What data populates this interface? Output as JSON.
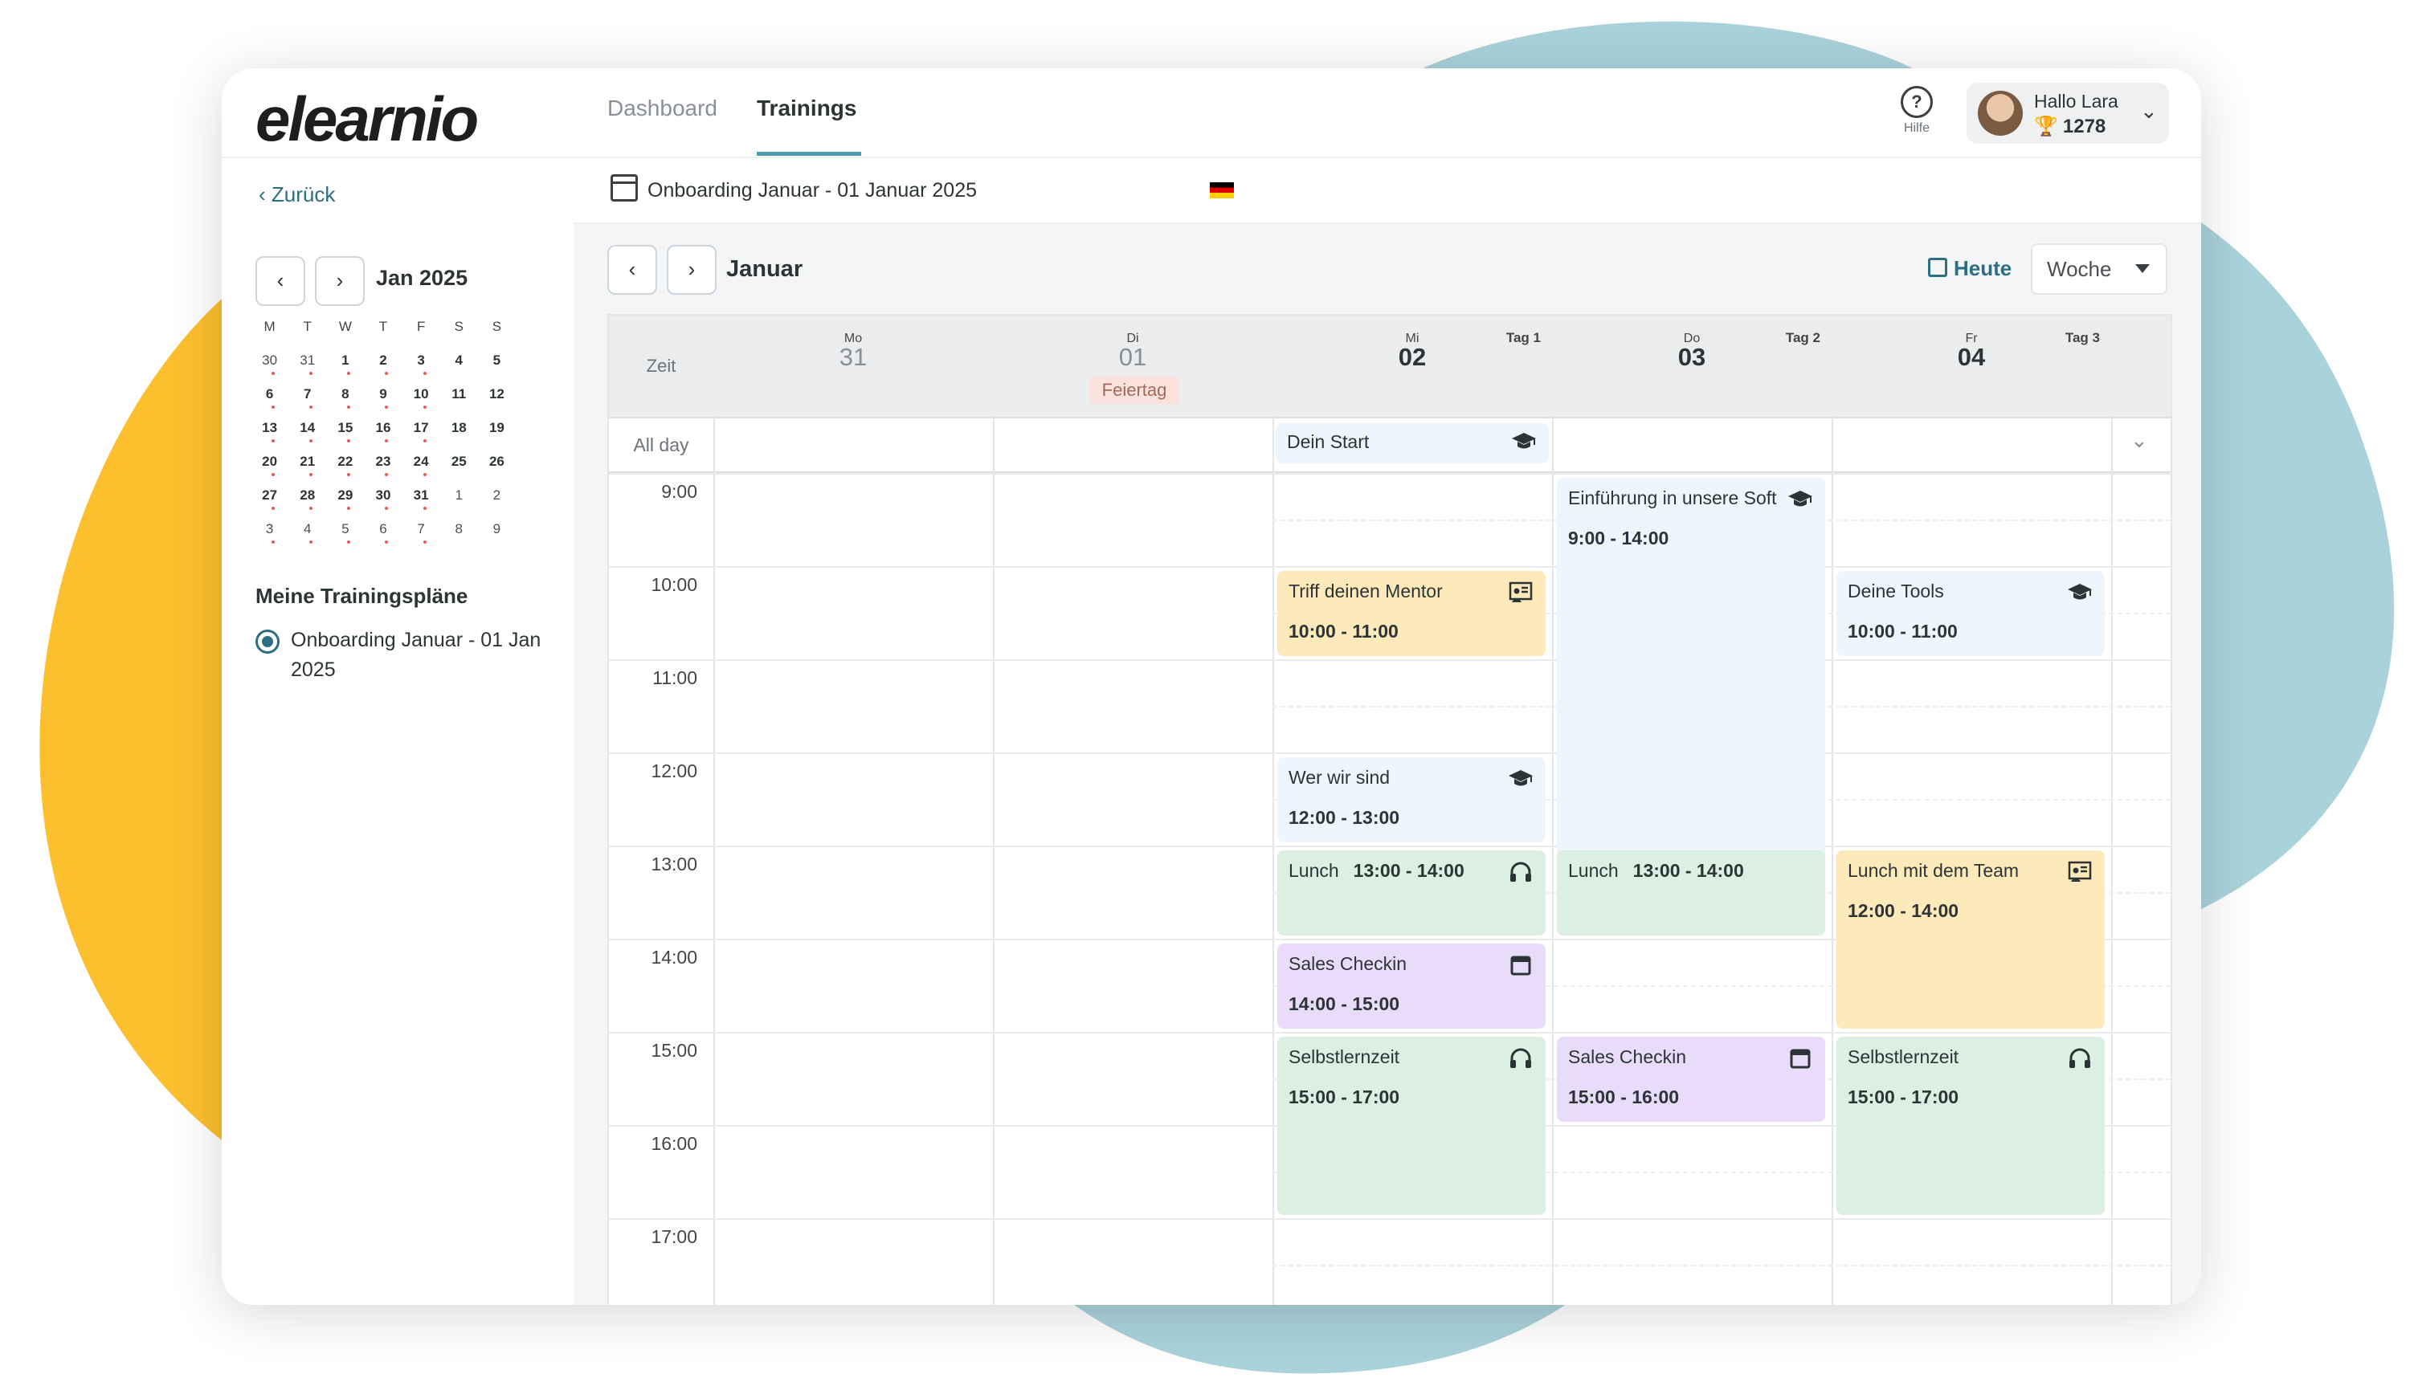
{
  "brand": {
    "logo_text": "elearnio"
  },
  "nav": {
    "tabs": [
      {
        "label": "Dashboard"
      },
      {
        "label": "Trainings"
      }
    ]
  },
  "help": {
    "label": "Hilfe"
  },
  "user": {
    "greeting": "Hallo Lara",
    "points": "1278"
  },
  "sidebar": {
    "back_label": "Zurück",
    "mini_calendar": {
      "title": "Jan 2025",
      "weekday_headers": [
        "M",
        "T",
        "W",
        "T",
        "F",
        "S",
        "S"
      ],
      "weeks": [
        [
          "30",
          "31",
          "1",
          "2",
          "3",
          "4",
          "5"
        ],
        [
          "6",
          "7",
          "8",
          "9",
          "10",
          "11",
          "12"
        ],
        [
          "13",
          "14",
          "15",
          "16",
          "17",
          "18",
          "19"
        ],
        [
          "20",
          "21",
          "22",
          "23",
          "24",
          "25",
          "26"
        ],
        [
          "27",
          "28",
          "29",
          "30",
          "31",
          "1",
          "2"
        ],
        [
          "3",
          "4",
          "5",
          "6",
          "7",
          "8",
          "9"
        ]
      ]
    },
    "plans_title": "Meine Trainingspläne",
    "plans": [
      {
        "label": "Onboarding Januar - 01 Jan 2025"
      }
    ]
  },
  "training_header": {
    "name": "Onboarding Januar - 01 Januar 2025"
  },
  "calendar": {
    "month_title": "Januar",
    "today_label": "Heute",
    "view_label": "Woche",
    "zeit_label": "Zeit",
    "allday_label": "All day",
    "days": [
      {
        "dow": "Mo",
        "num": "31",
        "tag": "",
        "holiday": ""
      },
      {
        "dow": "Di",
        "num": "01",
        "tag": "",
        "holiday": "Feiertag"
      },
      {
        "dow": "Mi",
        "num": "02",
        "tag": "Tag 1",
        "holiday": ""
      },
      {
        "dow": "Do",
        "num": "03",
        "tag": "Tag 2",
        "holiday": ""
      },
      {
        "dow": "Fr",
        "num": "04",
        "tag": "Tag 3",
        "holiday": ""
      }
    ],
    "times": [
      "9:00",
      "10:00",
      "11:00",
      "12:00",
      "13:00",
      "14:00",
      "15:00",
      "16:00",
      "17:00"
    ],
    "allday_events": [
      {
        "title": "Dein Start",
        "icon": "graduation-cap-icon"
      }
    ],
    "events": [
      {
        "title": "Triff deinen Mentor",
        "time": "10:00 - 11:00",
        "icon": "mentor-board-icon",
        "color": "#fde9b9"
      },
      {
        "title": "Wer wir sind",
        "time": "12:00 - 13:00",
        "icon": "graduation-cap-icon",
        "color": "#edf6fc"
      },
      {
        "title": "Lunch",
        "time": "13:00 - 14:00",
        "icon": "headphones-icon",
        "color": "#dcefe3"
      },
      {
        "title": "Sales Checkin",
        "time": "14:00 - 15:00",
        "icon": "calendar-icon",
        "color": "#e9dcfb"
      },
      {
        "title": "Selbstlernzeit",
        "time": "15:00 - 17:00",
        "icon": "headphones-icon",
        "color": "#dcefe3"
      },
      {
        "title": "Einführung in unsere Soft",
        "time": "9:00 - 14:00",
        "icon": "graduation-cap-icon",
        "color": "#edf6fc"
      },
      {
        "title": "Lunch",
        "time": "13:00 - 14:00",
        "icon": "",
        "color": "#dcefe3"
      },
      {
        "title": "Sales Checkin",
        "time": "15:00 - 16:00",
        "icon": "calendar-icon",
        "color": "#e9dcfb"
      },
      {
        "title": "Deine Tools",
        "time": "10:00 - 11:00",
        "icon": "graduation-cap-icon",
        "color": "#edf6fc"
      },
      {
        "title": "Lunch mit dem Team",
        "time": "12:00 - 14:00",
        "icon": "mentor-board-icon",
        "color": "#fde9b9"
      },
      {
        "title": "Selbstlernzeit",
        "time": "15:00 - 17:00",
        "icon": "headphones-icon",
        "color": "#dcefe3"
      }
    ]
  },
  "colors": {
    "accent": "#2d6e82",
    "blob_yellow": "#fcbf2e",
    "blob_teal": "#a9d3dc"
  }
}
